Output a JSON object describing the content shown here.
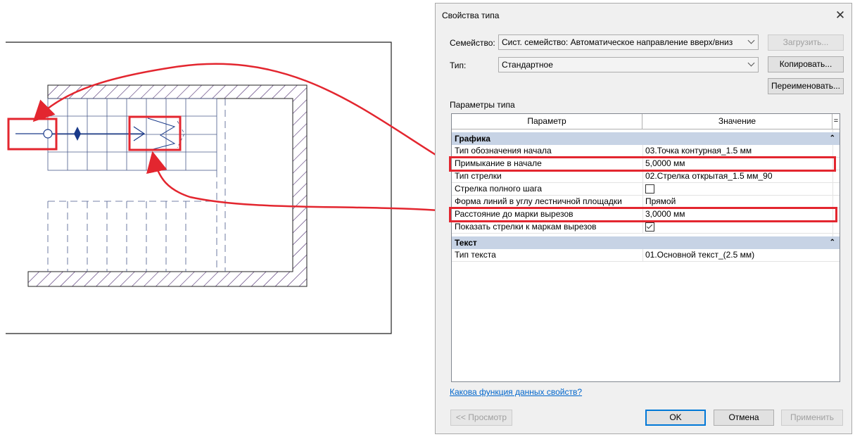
{
  "dialog": {
    "title": "Свойства типа",
    "close_glyph": "✕",
    "family_label": "Семейство:",
    "family_value": "Сист. семейство: Автоматическое направление вверх/вниз",
    "type_label": "Тип:",
    "type_value": "Стандартное",
    "load_button": "Загрузить...",
    "duplicate_button": "Копировать...",
    "rename_button": "Переименовать...",
    "params_label": "Параметры типа",
    "help_link": "Какова функция данных свойств?",
    "preview_button": "<< Просмотр",
    "ok_button": "OK",
    "cancel_button": "Отмена",
    "apply_button": "Применить"
  },
  "table": {
    "col_param": "Параметр",
    "col_value": "Значение",
    "col_sort": "=",
    "groups": [
      {
        "name": "Графика",
        "rows": [
          {
            "param": "Тип обозначения начала",
            "value": "03.Точка контурная_1.5 мм"
          },
          {
            "param": "Примыкание в начале",
            "value": "5,0000 мм"
          },
          {
            "param": "Тип стрелки",
            "value": "02.Стрелка открытая_1.5 мм_90"
          },
          {
            "param": "Стрелка полного шага",
            "value": "",
            "checkbox": false
          },
          {
            "param": "Форма линий в углу лестничной площадки",
            "value": "Прямой"
          },
          {
            "param": "Расстояние до марки вырезов",
            "value": "3,0000 мм"
          },
          {
            "param": "Показать стрелки к маркам вырезов",
            "value": "",
            "checkbox": true
          }
        ]
      },
      {
        "name": "Текст",
        "rows": [
          {
            "param": "Тип текста",
            "value": "01.Основной текст_(2.5 мм)"
          }
        ]
      }
    ]
  },
  "colors": {
    "highlight": "#e3262f",
    "group_header": "#c7d3e5",
    "link": "#0066cc",
    "annotation_line": "#1a3a8a"
  }
}
